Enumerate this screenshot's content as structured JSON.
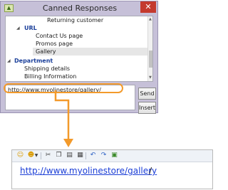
{
  "window": {
    "title": "Canned Responses",
    "app_icon_text": "▲",
    "close_glyph": "✕"
  },
  "tree": {
    "rows": [
      {
        "label": "Returning customer",
        "kind": "item",
        "indent": 3
      },
      {
        "label": "URL",
        "kind": "category",
        "indent": 2,
        "expanded": true
      },
      {
        "label": "Contact Us page",
        "kind": "item",
        "indent": 3
      },
      {
        "label": "Promos page",
        "kind": "item",
        "indent": 3
      },
      {
        "label": "Gallery",
        "kind": "item",
        "indent": 3,
        "selected": true
      },
      {
        "label": "Department",
        "kind": "category",
        "indent": 1,
        "expanded": true
      },
      {
        "label": "Shipping details",
        "kind": "item",
        "indent": 2
      },
      {
        "label": "Billing Information",
        "kind": "item",
        "indent": 2
      }
    ],
    "expand_arrow": "◢"
  },
  "response_text": "http://www.myolinestore/gallery/",
  "buttons": {
    "send": "Send",
    "insert": "Insert"
  },
  "editor": {
    "link_text": "http://www.myolinestore/gallery",
    "trailing_text": "/"
  },
  "colors": {
    "window_bg": "#c6c0d8",
    "category_text": "#1a3f9a",
    "highlight": "#f39a2b",
    "close_button": "#c43a2e",
    "link": "#1a3dd6"
  },
  "icons": {
    "close": "close-icon",
    "app": "app-icon",
    "toolbar": [
      "emoticon-icon",
      "emoji-dropdown-icon",
      "cut-icon",
      "copy-icon",
      "paste-icon",
      "paste-special-icon",
      "undo-icon",
      "redo-icon",
      "insert-image-icon"
    ]
  }
}
